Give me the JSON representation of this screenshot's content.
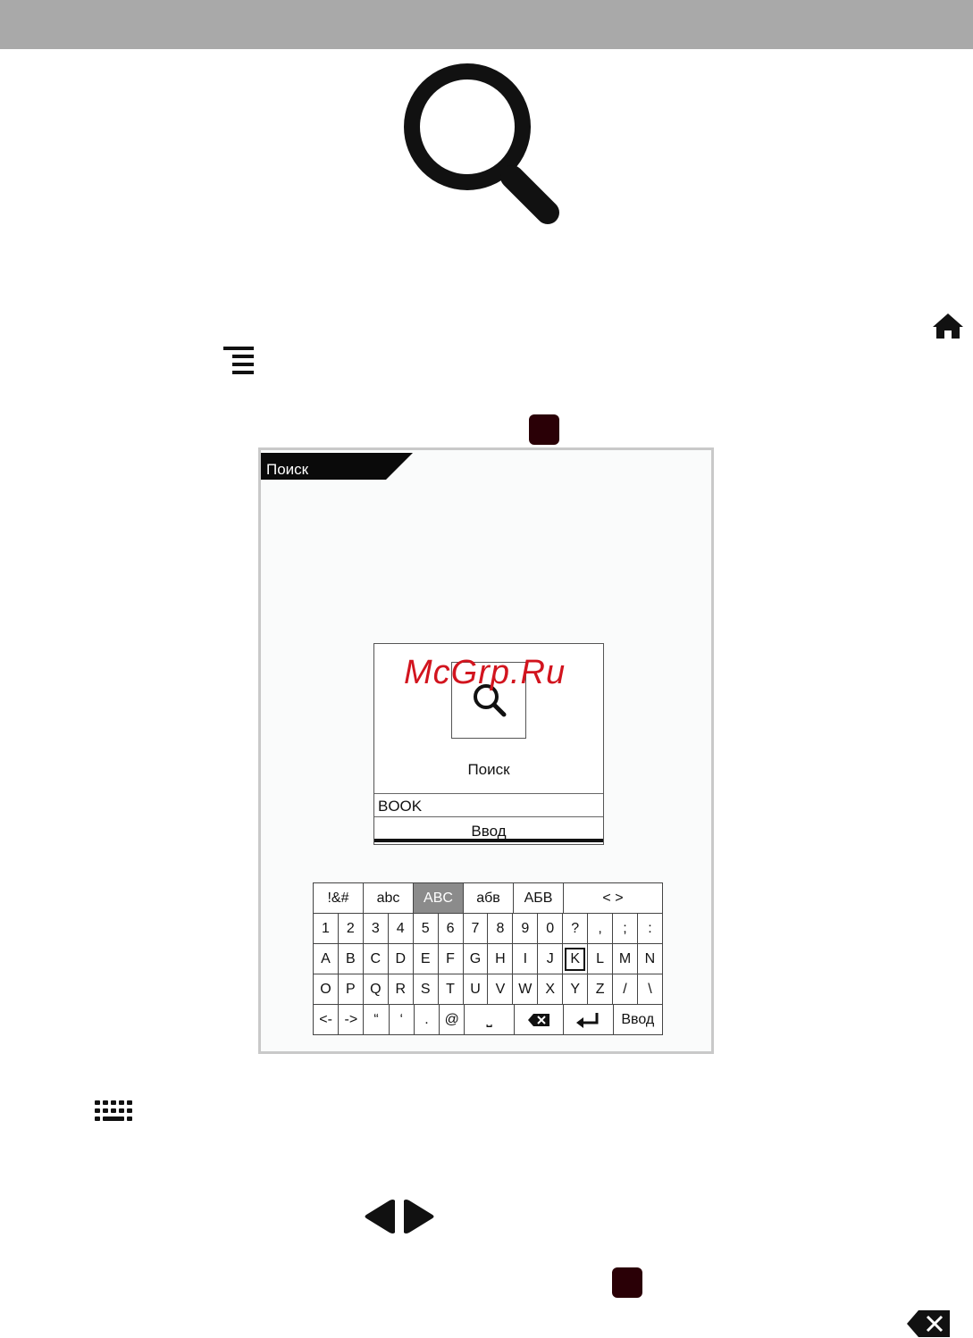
{
  "dialog": {
    "tab_label": "Поиск",
    "title": "Поиск",
    "input_value": "BOOK",
    "enter_label": "Ввод"
  },
  "watermark": "McGrp.Ru",
  "keyboard": {
    "rows": [
      [
        {
          "label": "!&#"
        },
        {
          "label": "abc"
        },
        {
          "label": "ABC",
          "active": true
        },
        {
          "label": "абв"
        },
        {
          "label": "АБВ"
        },
        {
          "label": "<    >",
          "span": 2
        }
      ],
      [
        {
          "label": "1"
        },
        {
          "label": "2"
        },
        {
          "label": "3"
        },
        {
          "label": "4"
        },
        {
          "label": "5"
        },
        {
          "label": "6"
        },
        {
          "label": "7"
        },
        {
          "label": "8"
        },
        {
          "label": "9"
        },
        {
          "label": "0"
        },
        {
          "label": "?"
        },
        {
          "label": ","
        },
        {
          "label": ";"
        },
        {
          "label": ":"
        }
      ],
      [
        {
          "label": "A"
        },
        {
          "label": "B"
        },
        {
          "label": "C"
        },
        {
          "label": "D"
        },
        {
          "label": "E"
        },
        {
          "label": "F"
        },
        {
          "label": "G"
        },
        {
          "label": "H"
        },
        {
          "label": "I"
        },
        {
          "label": "J"
        },
        {
          "label": "K",
          "selected": true
        },
        {
          "label": "L"
        },
        {
          "label": "M"
        },
        {
          "label": "N"
        }
      ],
      [
        {
          "label": "O"
        },
        {
          "label": "P"
        },
        {
          "label": "Q"
        },
        {
          "label": "R"
        },
        {
          "label": "S"
        },
        {
          "label": "T"
        },
        {
          "label": "U"
        },
        {
          "label": "V"
        },
        {
          "label": "W"
        },
        {
          "label": "X"
        },
        {
          "label": "Y"
        },
        {
          "label": "Z"
        },
        {
          "label": "/"
        },
        {
          "label": "\\"
        }
      ],
      [
        {
          "label": "<-"
        },
        {
          "label": "->"
        },
        {
          "label": "“"
        },
        {
          "label": "‘"
        },
        {
          "label": "."
        },
        {
          "label": "@"
        },
        {
          "label": "⎵",
          "span": 2
        },
        {
          "label": "",
          "icon": "backspace-icon",
          "span": 2
        },
        {
          "label": "",
          "icon": "enter-icon",
          "span": 2
        },
        {
          "label": "Ввод",
          "span": 2
        }
      ]
    ]
  },
  "icons": [
    "search-icon",
    "home-icon",
    "menu-icon",
    "keyboard-icon",
    "left-arrow-icon",
    "right-arrow-icon",
    "backspace-icon",
    "ok-button-icon"
  ]
}
